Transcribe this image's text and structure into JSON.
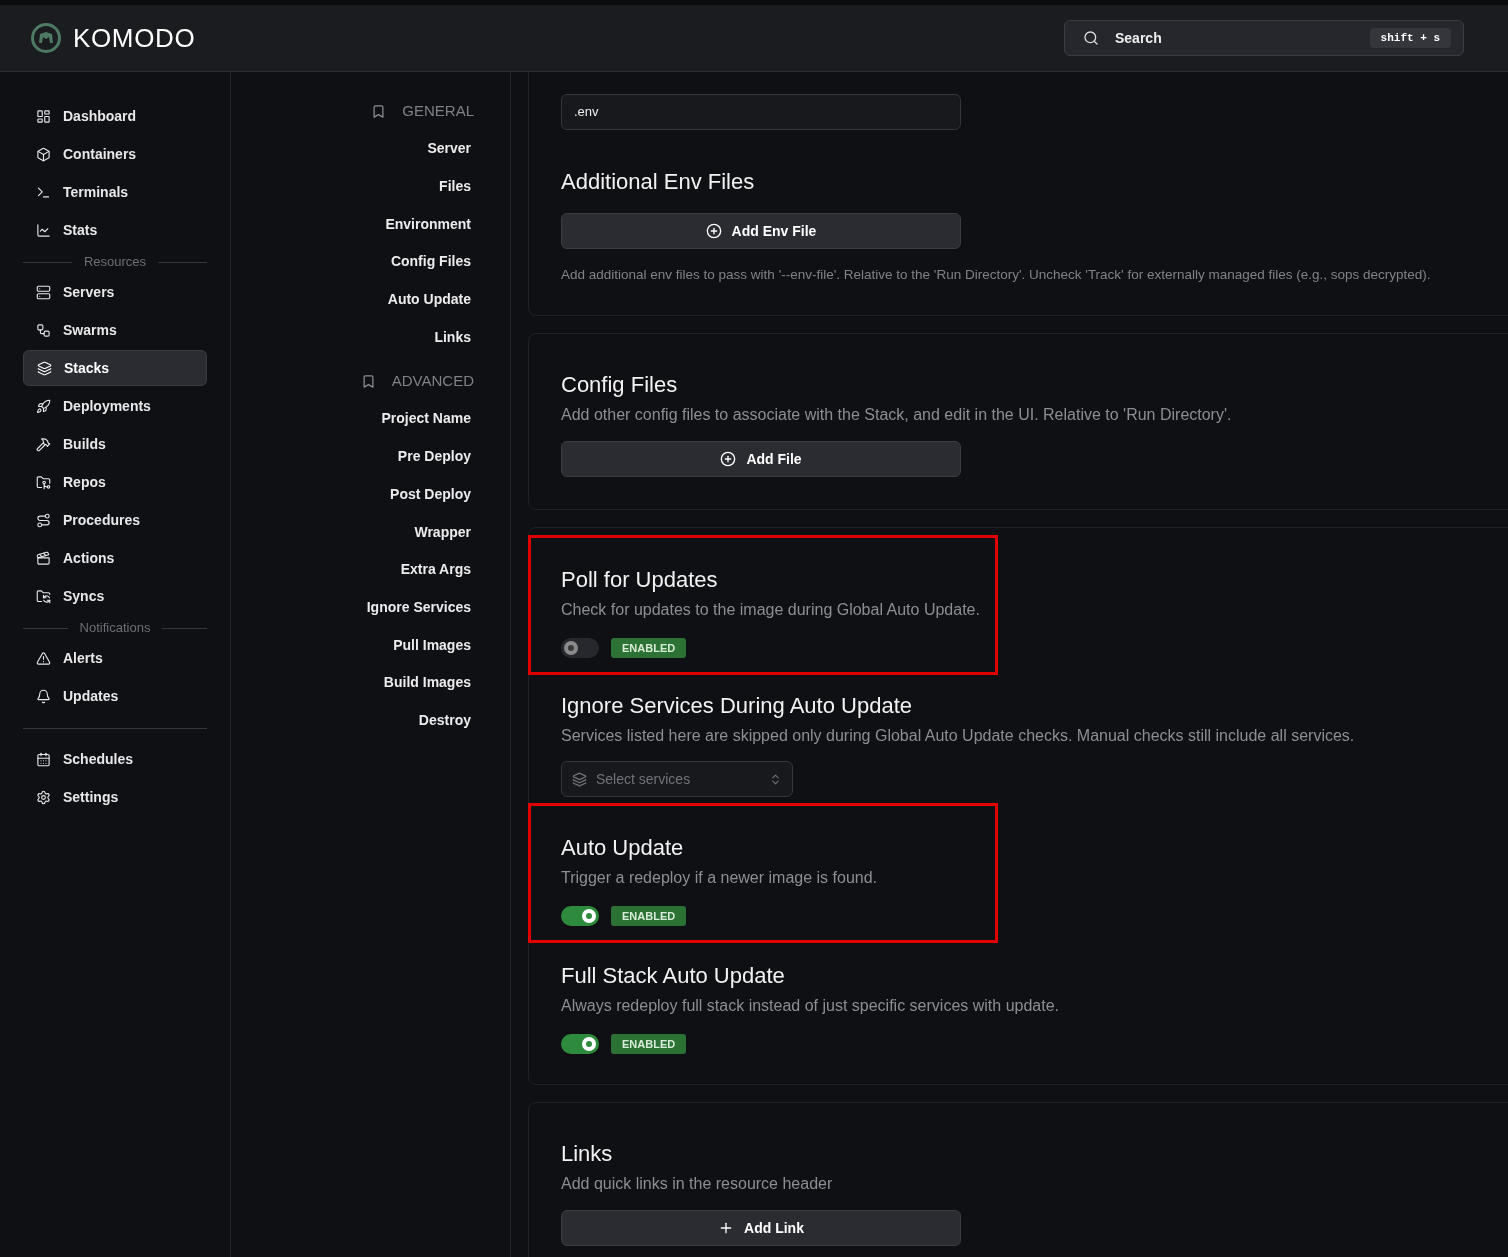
{
  "app": {
    "name": "KOMODO"
  },
  "search": {
    "placeholder": "Search",
    "shortcut": "shift + s"
  },
  "sidebar": {
    "items": [
      {
        "kind": "item",
        "label": "Dashboard",
        "selected": false
      },
      {
        "kind": "item",
        "label": "Containers",
        "selected": false
      },
      {
        "kind": "item",
        "label": "Terminals",
        "selected": false
      },
      {
        "kind": "item",
        "label": "Stats",
        "selected": false
      },
      {
        "kind": "divider",
        "label": "Resources"
      },
      {
        "kind": "item",
        "label": "Servers",
        "selected": false
      },
      {
        "kind": "item",
        "label": "Swarms",
        "selected": false
      },
      {
        "kind": "item",
        "label": "Stacks",
        "selected": true
      },
      {
        "kind": "item",
        "label": "Deployments",
        "selected": false
      },
      {
        "kind": "item",
        "label": "Builds",
        "selected": false
      },
      {
        "kind": "item",
        "label": "Repos",
        "selected": false
      },
      {
        "kind": "item",
        "label": "Procedures",
        "selected": false
      },
      {
        "kind": "item",
        "label": "Actions",
        "selected": false
      },
      {
        "kind": "item",
        "label": "Syncs",
        "selected": false
      },
      {
        "kind": "divider",
        "label": "Notifications"
      },
      {
        "kind": "item",
        "label": "Alerts",
        "selected": false
      },
      {
        "kind": "item",
        "label": "Updates",
        "selected": false
      },
      {
        "kind": "rule"
      },
      {
        "kind": "item",
        "label": "Schedules",
        "selected": false
      },
      {
        "kind": "item",
        "label": "Settings",
        "selected": false
      }
    ]
  },
  "config_nav": [
    {
      "heading": "GENERAL",
      "items": [
        "Server",
        "Files",
        "Environment",
        "Config Files",
        "Auto Update",
        "Links"
      ]
    },
    {
      "heading": "ADVANCED",
      "items": [
        "Project Name",
        "Pre Deploy",
        "Post Deploy",
        "Wrapper",
        "Extra Args",
        "Ignore Services",
        "Pull Images",
        "Build Images",
        "Destroy"
      ]
    }
  ],
  "cards": [
    {
      "sections": [
        {
          "kind": "input",
          "value": ".env"
        },
        {
          "kind": "files",
          "title": "Additional Env Files",
          "button": "Add Env File",
          "note": "Add additional env files to pass with '--env-file'. Relative to the 'Run Directory'. Uncheck 'Track' for externally managed files (e.g., sops decrypted)."
        }
      ]
    },
    {
      "sections": [
        {
          "kind": "files",
          "title": "Config Files",
          "description": "Add other config files to associate with the Stack, and edit in the UI. Relative to 'Run Directory'.",
          "button": "Add File"
        }
      ]
    },
    {
      "sections": [
        {
          "kind": "toggle",
          "title": "Poll for Updates",
          "description": "Check for updates to the image during Global Auto Update.",
          "on": false,
          "badge": "ENABLED",
          "highlighted": true
        },
        {
          "kind": "select",
          "title": "Ignore Services During Auto Update",
          "description": "Services listed here are skipped only during Global Auto Update checks. Manual checks still include all services.",
          "placeholder": "Select services"
        },
        {
          "kind": "toggle",
          "title": "Auto Update",
          "description": "Trigger a redeploy if a newer image is found.",
          "on": true,
          "badge": "ENABLED",
          "highlighted": true
        },
        {
          "kind": "toggle",
          "title": "Full Stack Auto Update",
          "description": "Always redeploy full stack instead of just specific services with update.",
          "on": true,
          "badge": "ENABLED"
        }
      ]
    },
    {
      "sections": [
        {
          "kind": "links",
          "title": "Links",
          "description": "Add quick links in the resource header",
          "button": "Add Link"
        }
      ]
    }
  ]
}
